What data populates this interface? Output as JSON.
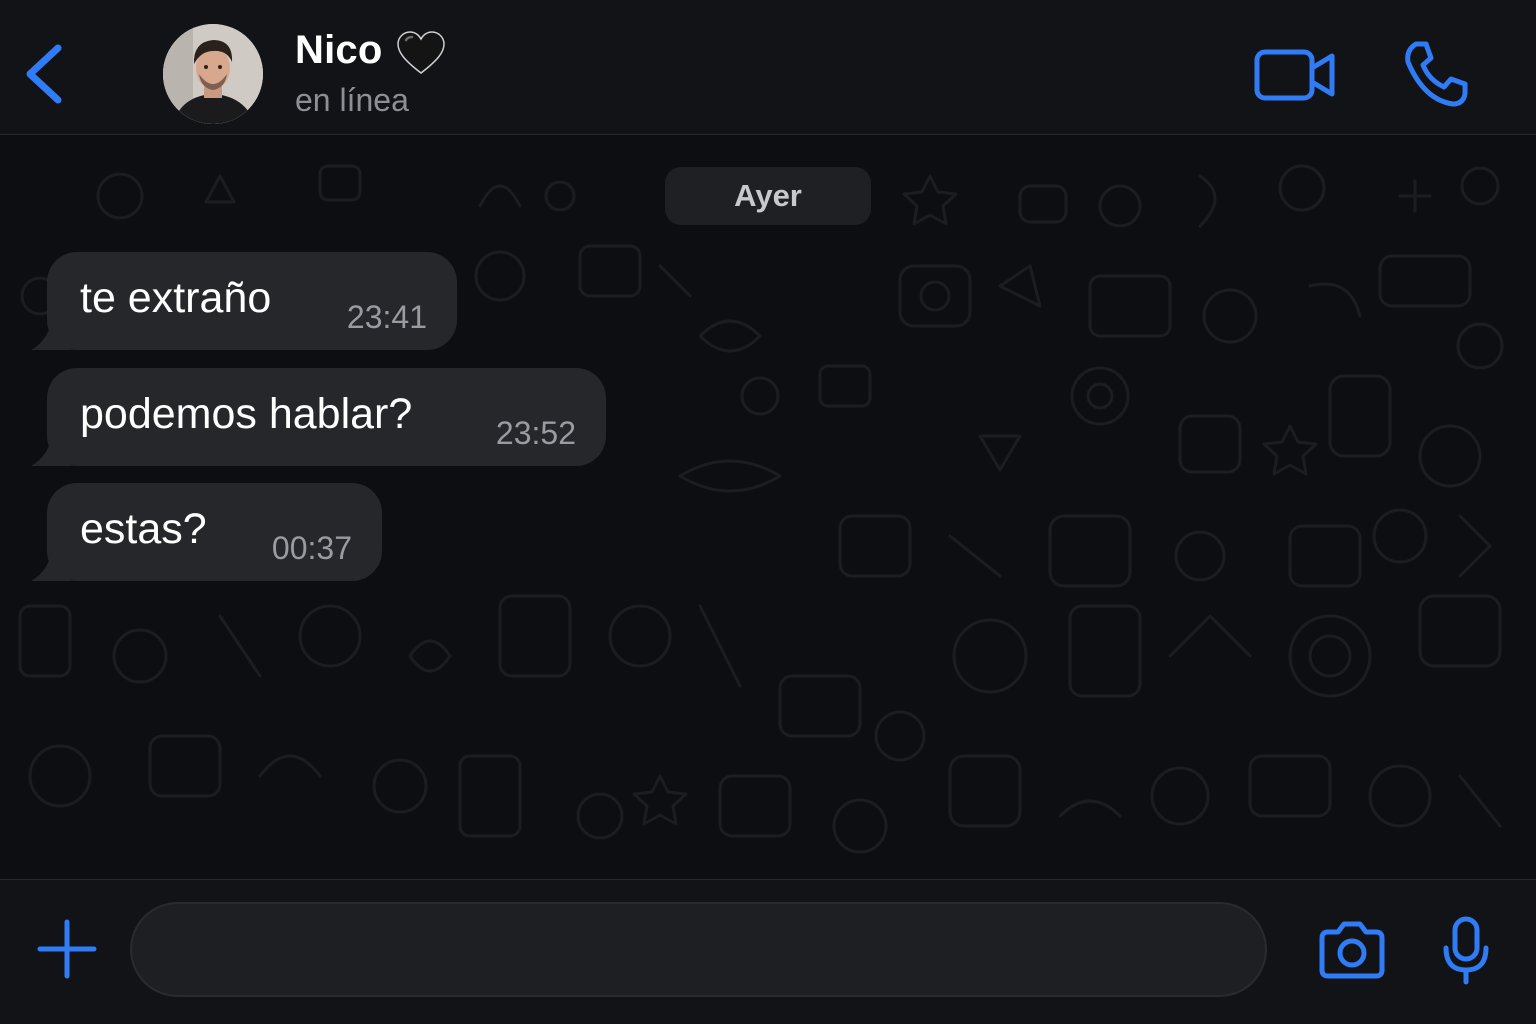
{
  "colors": {
    "accent": "#2f7cf6",
    "header_bg": "#111316",
    "chat_bg": "#0d0e11",
    "bubble_bg": "#26272b",
    "text_primary": "#ffffff",
    "text_secondary": "#8d8f94"
  },
  "header": {
    "back_icon": "chevron-left-icon",
    "contact_name": "Nico",
    "contact_emoji": "black-heart-icon",
    "status": "en línea",
    "video_icon": "video-camera-icon",
    "call_icon": "phone-icon"
  },
  "chat": {
    "date_label": "Ayer",
    "messages": [
      {
        "text": "te extraño",
        "time": "23:41",
        "direction": "incoming"
      },
      {
        "text": "podemos hablar?",
        "time": "23:52",
        "direction": "incoming"
      },
      {
        "text": "estas?",
        "time": "00:37",
        "direction": "incoming"
      }
    ]
  },
  "composer": {
    "plus_icon": "plus-icon",
    "input_value": "",
    "input_placeholder": "",
    "camera_icon": "camera-icon",
    "mic_icon": "microphone-icon"
  }
}
